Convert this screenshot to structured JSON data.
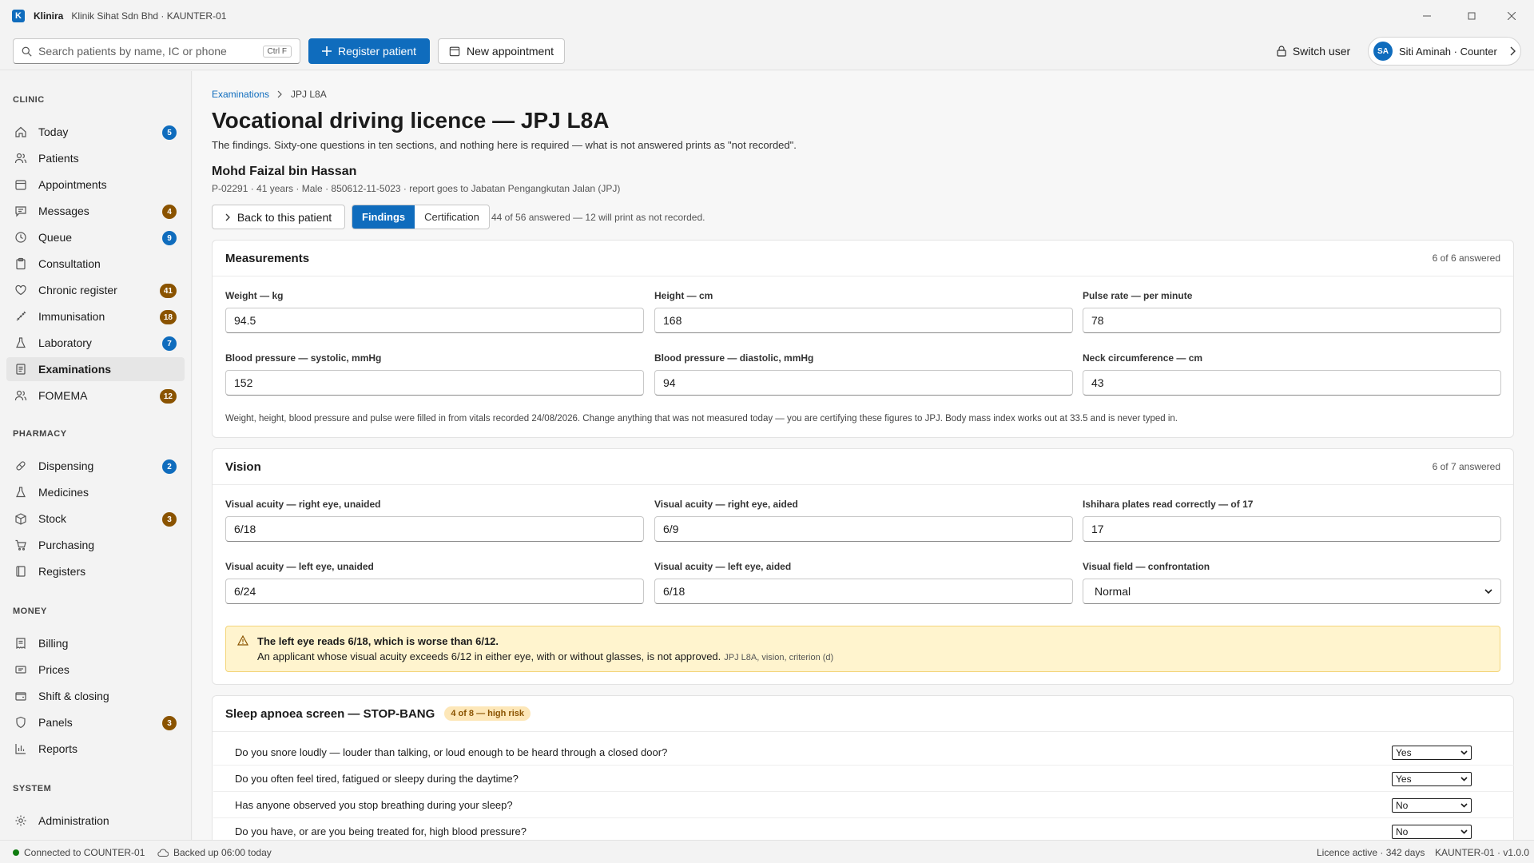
{
  "titlebar": {
    "app_name": "Klinira",
    "window_title": "Klinik Sihat Sdn Bhd · KAUNTER-01",
    "logo_letter": "K"
  },
  "toolbar": {
    "search_placeholder": "Search patients by name, IC or phone",
    "search_shortcut": "Ctrl F",
    "register_label": "Register patient",
    "new_appointment_label": "New appointment",
    "switch_user_label": "Switch user",
    "user_initials": "SA",
    "user_label": "Siti Aminah · Counter"
  },
  "sidebar": {
    "clinic_heading": "CLINIC",
    "clinic": [
      {
        "label": "Today",
        "badge": "5",
        "icon": "home-icon"
      },
      {
        "label": "Patients",
        "badge": "",
        "icon": "people-icon"
      },
      {
        "label": "Appointments",
        "badge": "",
        "icon": "calendar-icon"
      },
      {
        "label": "Messages",
        "badge": "4",
        "icon": "chat-icon"
      },
      {
        "label": "Queue",
        "badge": "9",
        "icon": "clock-icon"
      },
      {
        "label": "Consultation",
        "badge": "",
        "icon": "clipboard-icon"
      },
      {
        "label": "Chronic register",
        "badge": "41",
        "icon": "heart-icon"
      },
      {
        "label": "Immunisation",
        "badge": "18",
        "icon": "syringe-icon"
      },
      {
        "label": "Laboratory",
        "badge": "7",
        "icon": "flask-icon"
      },
      {
        "label": "Examinations",
        "badge": "",
        "icon": "document-icon"
      },
      {
        "label": "FOMEMA",
        "badge": "12",
        "icon": "people-icon"
      }
    ],
    "pharmacy_heading": "PHARMACY",
    "pharmacy": [
      {
        "label": "Dispensing",
        "badge": "2",
        "icon": "pill-icon"
      },
      {
        "label": "Medicines",
        "badge": "",
        "icon": "flask-icon"
      },
      {
        "label": "Stock",
        "badge": "3",
        "icon": "box-icon"
      },
      {
        "label": "Purchasing",
        "badge": "",
        "icon": "cart-icon"
      },
      {
        "label": "Registers",
        "badge": "",
        "icon": "book-icon"
      }
    ],
    "money_heading": "MONEY",
    "money": [
      {
        "label": "Billing",
        "badge": "",
        "icon": "receipt-icon"
      },
      {
        "label": "Prices",
        "badge": "",
        "icon": "tag-icon"
      },
      {
        "label": "Shift & closing",
        "badge": "",
        "icon": "wallet-icon"
      },
      {
        "label": "Panels",
        "badge": "3",
        "icon": "shield-icon"
      },
      {
        "label": "Reports",
        "badge": "",
        "icon": "chart-icon"
      }
    ],
    "system_heading": "SYSTEM",
    "system": [
      {
        "label": "Administration",
        "badge": "",
        "icon": "gear-icon"
      }
    ]
  },
  "breadcrumb": {
    "parent": "Examinations",
    "current": "JPJ L8A"
  },
  "page": {
    "title": "Vocational driving licence — JPJ L8A",
    "subtitle": "The findings. Sixty-one questions in ten sections, and nothing here is required — what is not answered prints as \"not recorded\"."
  },
  "patient": {
    "name": "Mohd Faizal bin Hassan",
    "meta": "P-02291 · 41 years · Male · 850612-11-5023 · report goes to Jabatan Pengangkutan Jalan (JPJ)"
  },
  "actions": {
    "back_label": "Back to this patient",
    "tab_findings": "Findings",
    "tab_certification": "Certification",
    "progress_note": "44 of 56 answered — 12 will print as not recorded."
  },
  "measurements": {
    "title": "Measurements",
    "count": "6 of 6 answered",
    "fields": [
      {
        "label": "Weight — kg",
        "value": "94.5"
      },
      {
        "label": "Height — cm",
        "value": "168"
      },
      {
        "label": "Pulse rate — per minute",
        "value": "78"
      },
      {
        "label": "Blood pressure — systolic, mmHg",
        "value": "152"
      },
      {
        "label": "Blood pressure — diastolic, mmHg",
        "value": "94"
      },
      {
        "label": "Neck circumference — cm",
        "value": "43"
      }
    ],
    "note": "Weight, height, blood pressure and pulse were filled in from vitals recorded 24/08/2026. Change anything that was not measured today — you are certifying these figures to JPJ. Body mass index works out at 33.5 and is never typed in."
  },
  "vision": {
    "title": "Vision",
    "count": "6 of 7 answered",
    "fields": [
      {
        "label": "Visual acuity — right eye, unaided",
        "value": "6/18"
      },
      {
        "label": "Visual acuity — right eye, aided",
        "value": "6/9"
      },
      {
        "label": "Ishihara plates read correctly — of 17",
        "value": "17"
      },
      {
        "label": "Visual acuity — left eye, unaided",
        "value": "6/24"
      },
      {
        "label": "Visual acuity — left eye, aided",
        "value": "6/18"
      },
      {
        "label": "Visual field — confrontation",
        "value": "Normal"
      }
    ],
    "warning_title": "The left eye reads 6/18, which is worse than 6/12.",
    "warning_body": "An applicant whose visual acuity exceeds 6/12 in either eye, with or without glasses, is not approved.",
    "warning_ref": "JPJ L8A, vision, criterion (d)"
  },
  "stopbang": {
    "title": "Sleep apnoea screen — STOP-BANG",
    "risk_pill": "4 of 8 — high risk",
    "questions": [
      {
        "text": "Do you snore loudly — louder than talking, or loud enough to be heard through a closed door?",
        "answer": "Yes"
      },
      {
        "text": "Do you often feel tired, fatigued or sleepy during the daytime?",
        "answer": "Yes"
      },
      {
        "text": "Has anyone observed you stop breathing during your sleep?",
        "answer": "No"
      },
      {
        "text": "Do you have, or are you being treated for, high blood pressure?",
        "answer": "No"
      }
    ]
  },
  "status": {
    "connection": "Connected to COUNTER-01",
    "backup": "Backed up 06:00 today",
    "licence": "Licence active · 342 days",
    "version": "KAUNTER-01 · v1.0.0"
  },
  "colors": {
    "accent": "#0f6cbd",
    "badge_brown": "#8a5300",
    "warning_bg": "#fff4ce",
    "online": "#107c10"
  }
}
